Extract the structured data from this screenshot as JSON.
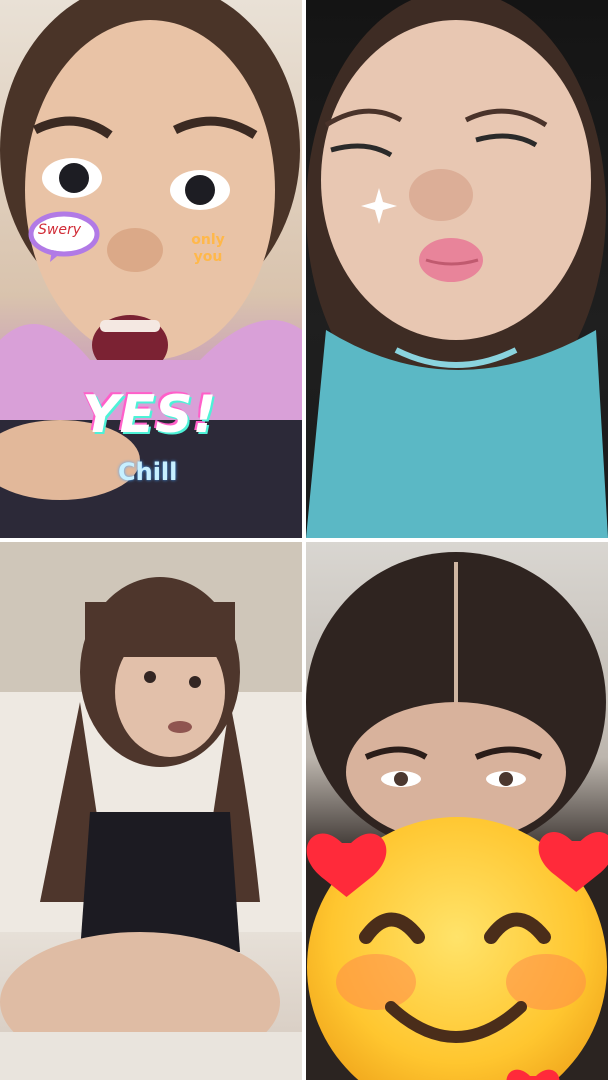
{
  "tiles": [
    {
      "stickers": {
        "bubble": "Swery",
        "cheek": "only you",
        "yes": "YES!",
        "chill": "Chill"
      }
    },
    {
      "stickers": {
        "sparkle": "sparkle-icon"
      }
    },
    {},
    {
      "stickers": {
        "emoji": "smiling-face-with-hearts-icon"
      }
    }
  ],
  "colors": {
    "divider": "#ffffff",
    "emoji_face": "#ffd23a",
    "heart": "#ff2a3a"
  }
}
